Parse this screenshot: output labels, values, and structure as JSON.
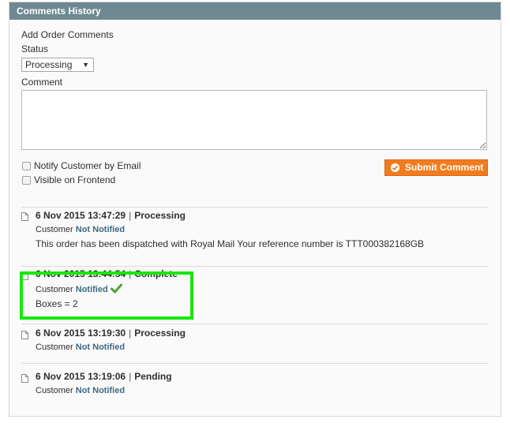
{
  "panel": {
    "title": "Comments History"
  },
  "form": {
    "heading": "Add Order Comments",
    "status_label": "Status",
    "status_selected": "Processing",
    "comment_label": "Comment",
    "comment_value": "",
    "notify_label": "Notify Customer by Email",
    "visible_label": "Visible on Frontend",
    "submit_label": "Submit Comment"
  },
  "history": [
    {
      "date": "6 Nov 2015",
      "time": "13:47:29",
      "status": "Processing",
      "customer_label": "Customer",
      "notified": "Not Notified",
      "message": "This order has been dispatched with Royal Mail Your reference number is TTT000382168GB"
    },
    {
      "date": "6 Nov 2015",
      "time": "13:44:54",
      "status": "Complete",
      "customer_label": "Customer",
      "notified": "Notified",
      "message": "Boxes = 2"
    },
    {
      "date": "6 Nov 2015",
      "time": "13:19:30",
      "status": "Processing",
      "customer_label": "Customer",
      "notified": "Not Notified",
      "message": ""
    },
    {
      "date": "6 Nov 2015",
      "time": "13:19:06",
      "status": "Pending",
      "customer_label": "Customer",
      "notified": "Not Notified",
      "message": ""
    }
  ],
  "colors": {
    "header_bg": "#6f8992",
    "submit_bg": "#f17c1f",
    "status_link": "#3d6b82",
    "highlight": "#16e80c",
    "check": "#4aa52e"
  },
  "icons": {
    "entry": "document-icon",
    "notified": "green-check-icon",
    "submit": "ok-circle-icon"
  }
}
